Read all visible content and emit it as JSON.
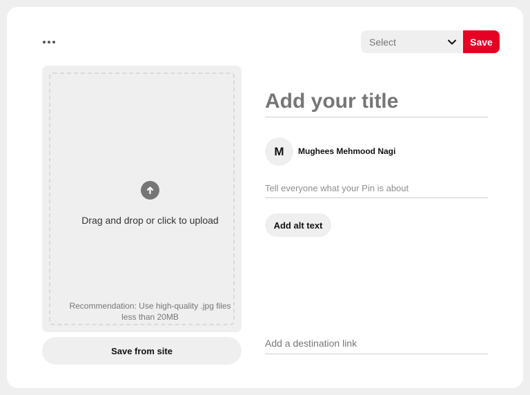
{
  "toolbar": {
    "more_icon": "ellipsis-icon",
    "board_select": {
      "value": "Select",
      "icon": "chevron-down-icon"
    },
    "save_label": "Save",
    "save_color": "#e60023"
  },
  "upload": {
    "icon": "arrow-up-icon",
    "instruction": "Drag and drop or click to upload",
    "recommendation": "Recommendation: Use high-quality .jpg files less than 20MB"
  },
  "save_from_site_label": "Save from site",
  "form": {
    "title_placeholder": "Add your title",
    "user": {
      "initial": "M",
      "name": "Mughees Mehmood Nagi"
    },
    "description_placeholder": "Tell everyone what your Pin is about",
    "alt_text_label": "Add alt text",
    "link_placeholder": "Add a destination link"
  }
}
